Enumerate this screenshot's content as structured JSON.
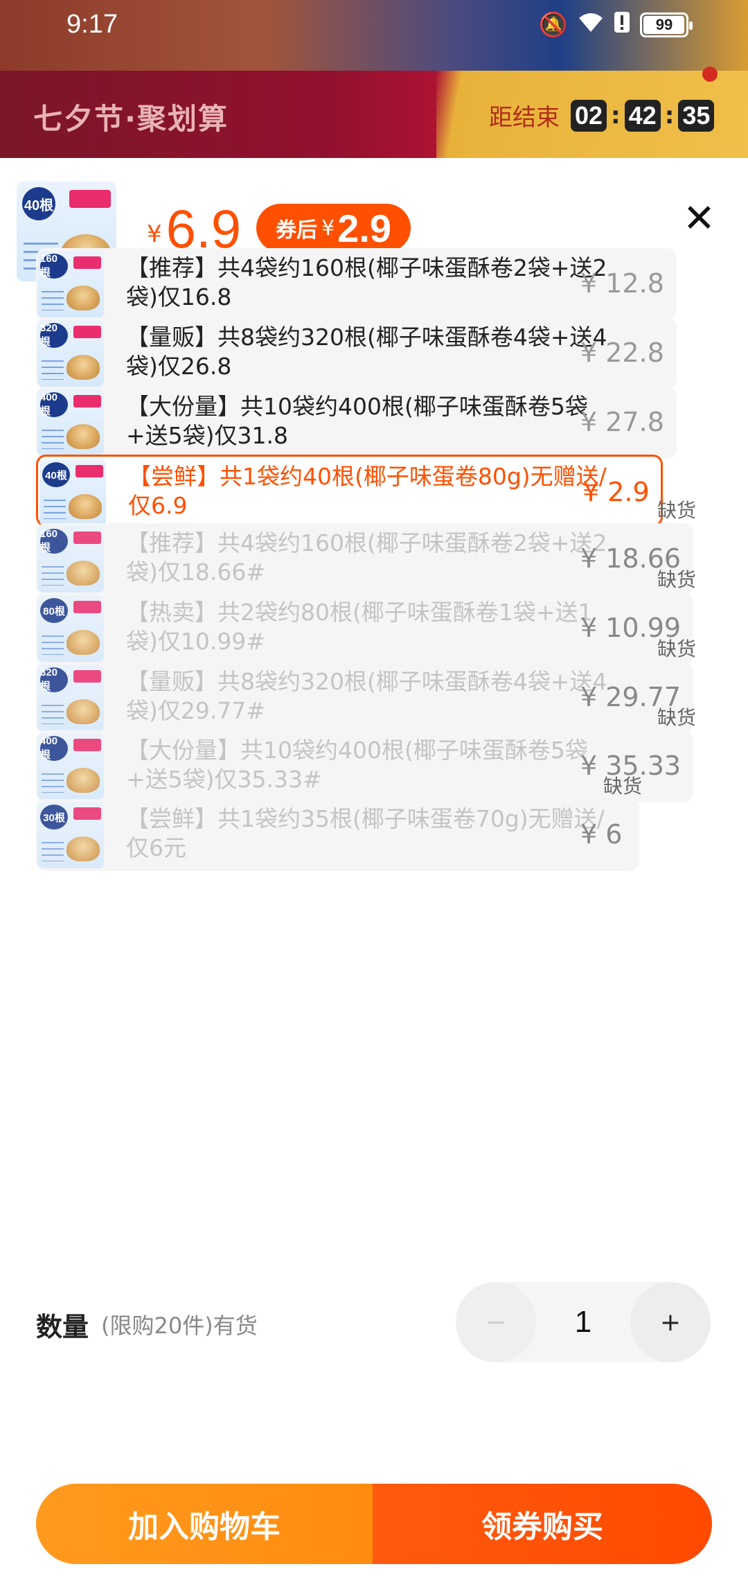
{
  "status_bar": {
    "time": "9:17",
    "battery_level": "99",
    "battery_fraction": 0.99,
    "icons": [
      "mute-icon",
      "wifi-icon",
      "alert-icon",
      "battery-icon"
    ]
  },
  "banner": {
    "campaign": "七夕节·聚划算",
    "countdown_label": "距结束",
    "hours": "02",
    "minutes": "42",
    "seconds": "35",
    "colors": {
      "banner_red": "#93112e",
      "countdown_text": "#b02d19"
    }
  },
  "product": {
    "currency": "¥",
    "price": "6.9",
    "coupon_label": "券后",
    "coupon_price": "2.9",
    "thumb_badge": "40根"
  },
  "options": [
    {
      "text": "【推荐】共4袋约160根(椰子味蛋酥卷2袋+送2袋)仅16.8",
      "price": "¥ 12.8",
      "badge": "160根",
      "state": "normal",
      "soldout": ""
    },
    {
      "text": "【量贩】共8袋约320根(椰子味蛋酥卷4袋+送4袋)仅26.8",
      "price": "¥ 22.8",
      "badge": "320根",
      "state": "normal",
      "soldout": ""
    },
    {
      "text": "【大份量】共10袋约400根(椰子味蛋酥卷5袋+送5袋)仅31.8",
      "price": "¥ 27.8",
      "badge": "400根",
      "state": "normal",
      "soldout": ""
    },
    {
      "text": "【尝鲜】共1袋约40根(椰子味蛋卷80g)无赠送/仅6.9",
      "price": "¥ 2.9",
      "badge": "40根",
      "state": "selected",
      "soldout": ""
    },
    {
      "text": "【推荐】共4袋约160根(椰子味蛋酥卷2袋+送2袋)仅18.66#",
      "price": "¥ 18.66",
      "badge": "160根",
      "state": "disabled",
      "soldout": "缺货"
    },
    {
      "text": "【热卖】共2袋约80根(椰子味蛋酥卷1袋+送1袋)仅10.99#",
      "price": "¥ 10.99",
      "badge": "80根",
      "state": "disabled",
      "soldout": "缺货"
    },
    {
      "text": "【量贩】共8袋约320根(椰子味蛋酥卷4袋+送4袋)仅29.77#",
      "price": "¥ 29.77",
      "badge": "320根",
      "state": "disabled",
      "soldout": "缺货"
    },
    {
      "text": "【大份量】共10袋约400根(椰子味蛋酥卷5袋+送5袋)仅35.33#",
      "price": "¥ 35.33",
      "badge": "400根",
      "state": "disabled",
      "soldout": "缺货"
    },
    {
      "text": "【尝鲜】共1袋约35根(椰子味蛋卷70g)无赠送/仅6元",
      "price": "¥ 6",
      "badge": "30根",
      "state": "disabled",
      "soldout": "缺货"
    }
  ],
  "quantity": {
    "label": "数量",
    "limit": "(限购20件)有货",
    "value": "1",
    "minus": "−",
    "plus": "+"
  },
  "actions": {
    "add_to_cart": "加入购物车",
    "buy_with_coupon": "领券购买"
  },
  "colors": {
    "accent": "#ff5000",
    "cart_button": "#ff9a1e",
    "buy_button": "#ff5000"
  }
}
